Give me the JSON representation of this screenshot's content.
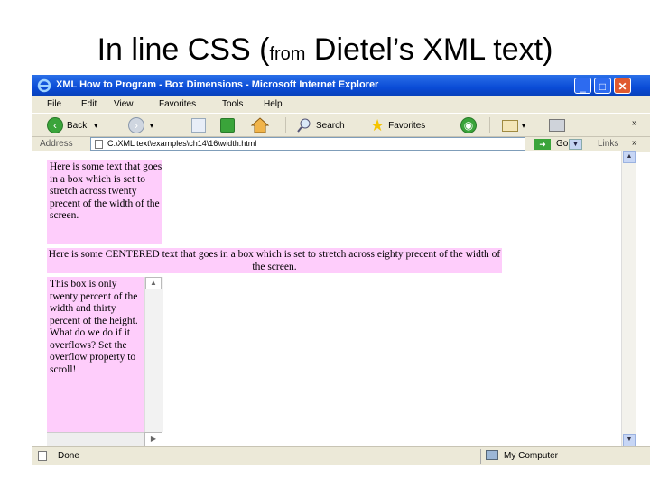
{
  "slide": {
    "title_before": "In line CSS (",
    "title_small": "from",
    "title_after": " Dietel’s XML text)"
  },
  "window": {
    "title": "XML How to Program - Box Dimensions - Microsoft Internet Explorer",
    "min": "_",
    "max": "□",
    "close": "✕"
  },
  "menu": [
    "File",
    "Edit",
    "View",
    "Favorites",
    "Tools",
    "Help"
  ],
  "toolbar": {
    "back": "Back",
    "search": "Search",
    "favorites": "Favorites",
    "more": "»"
  },
  "address": {
    "label": "Address",
    "value": "C:\\XML text\\examples\\ch14\\16\\width.html",
    "go": "Go",
    "links": "Links",
    "more": "»"
  },
  "page": {
    "box1_text": "Here is some text that goes in a box which is set to stretch across twenty precent of the width of the screen.",
    "box2_text": "Here is some CENTERED text that goes in a box which is set to stretch across eighty precent of the width of the screen.",
    "box3_text": "This box is only twenty percent of the width and thirty percent of the height. What do we do if it overflows? Set the overflow property to scroll!"
  },
  "status": {
    "left": "Done",
    "right": "My Computer"
  },
  "colors": {
    "box_bg": "#fecdfb",
    "titlebar": "#0a4bd6",
    "chrome": "#ece9d8"
  }
}
